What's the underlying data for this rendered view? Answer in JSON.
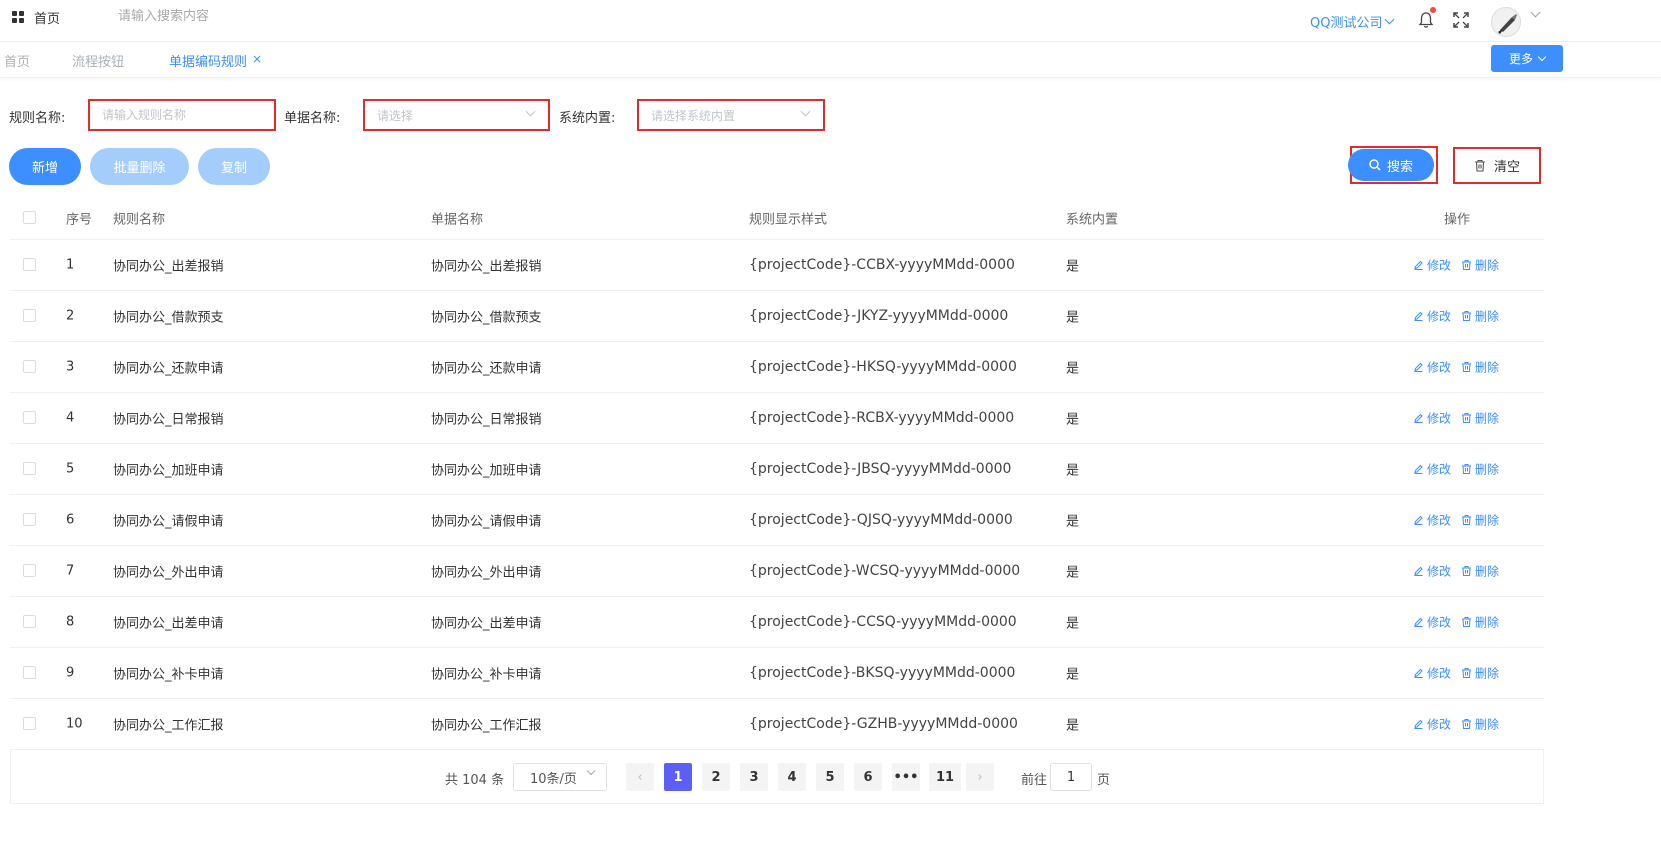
{
  "header": {
    "home_label": "首页",
    "search_placeholder": "请输入搜索内容",
    "company": "QQ测试公司",
    "icons": [
      "grid-icon",
      "bell-icon",
      "fullscreen-icon",
      "avatar"
    ]
  },
  "tabs": {
    "items": [
      {
        "label": "首页",
        "active": false
      },
      {
        "label": "流程按钮",
        "active": false
      },
      {
        "label": "单据编码规则",
        "active": true
      }
    ],
    "close_glyph": "×",
    "more_label": "更多"
  },
  "filters": {
    "rule_name_label": "规则名称:",
    "rule_name_placeholder": "请输入规则名称",
    "doc_name_label": "单据名称:",
    "doc_name_placeholder": "请选择",
    "system_label": "系统内置:",
    "system_placeholder": "请选择系统内置"
  },
  "actions": {
    "add": "新增",
    "batch_delete": "批量删除",
    "copy": "复制",
    "search": "搜索",
    "clear": "清空"
  },
  "table": {
    "columns": [
      "序号",
      "规则名称",
      "单据名称",
      "规则显示样式",
      "系统内置",
      "操作"
    ],
    "op_edit": "修改",
    "op_delete": "删除",
    "rows": [
      {
        "no": "1",
        "name": "协同办公_出差报销",
        "doc": "协同办公_出差报销",
        "style": "{projectCode}-CCBX-yyyyMMdd-0000",
        "sys": "是"
      },
      {
        "no": "2",
        "name": "协同办公_借款预支",
        "doc": "协同办公_借款预支",
        "style": "{projectCode}-JKYZ-yyyyMMdd-0000",
        "sys": "是"
      },
      {
        "no": "3",
        "name": "协同办公_还款申请",
        "doc": "协同办公_还款申请",
        "style": "{projectCode}-HKSQ-yyyyMMdd-0000",
        "sys": "是"
      },
      {
        "no": "4",
        "name": "协同办公_日常报销",
        "doc": "协同办公_日常报销",
        "style": "{projectCode}-RCBX-yyyyMMdd-0000",
        "sys": "是"
      },
      {
        "no": "5",
        "name": "协同办公_加班申请",
        "doc": "协同办公_加班申请",
        "style": "{projectCode}-JBSQ-yyyyMMdd-0000",
        "sys": "是"
      },
      {
        "no": "6",
        "name": "协同办公_请假申请",
        "doc": "协同办公_请假申请",
        "style": "{projectCode}-QJSQ-yyyyMMdd-0000",
        "sys": "是"
      },
      {
        "no": "7",
        "name": "协同办公_外出申请",
        "doc": "协同办公_外出申请",
        "style": "{projectCode}-WCSQ-yyyyMMdd-0000",
        "sys": "是"
      },
      {
        "no": "8",
        "name": "协同办公_出差申请",
        "doc": "协同办公_出差申请",
        "style": "{projectCode}-CCSQ-yyyyMMdd-0000",
        "sys": "是"
      },
      {
        "no": "9",
        "name": "协同办公_补卡申请",
        "doc": "协同办公_补卡申请",
        "style": "{projectCode}-BKSQ-yyyyMMdd-0000",
        "sys": "是"
      },
      {
        "no": "10",
        "name": "协同办公_工作汇报",
        "doc": "协同办公_工作汇报",
        "style": "{projectCode}-GZHB-yyyyMMdd-0000",
        "sys": "是"
      }
    ]
  },
  "pagination": {
    "total": "共 104 条",
    "page_size": "10条/页",
    "pages": [
      "1",
      "2",
      "3",
      "4",
      "5",
      "6",
      "•••",
      "11"
    ],
    "current": "1",
    "prev_glyph": "‹",
    "next_glyph": "›",
    "goto_label": "前往",
    "goto_value": "1",
    "goto_unit": "页"
  },
  "colors": {
    "primary": "#3d8eff",
    "primary_light": "#a5cdfc",
    "highlight_border": "#e52a2a",
    "active_page": "#5b5ff5"
  }
}
